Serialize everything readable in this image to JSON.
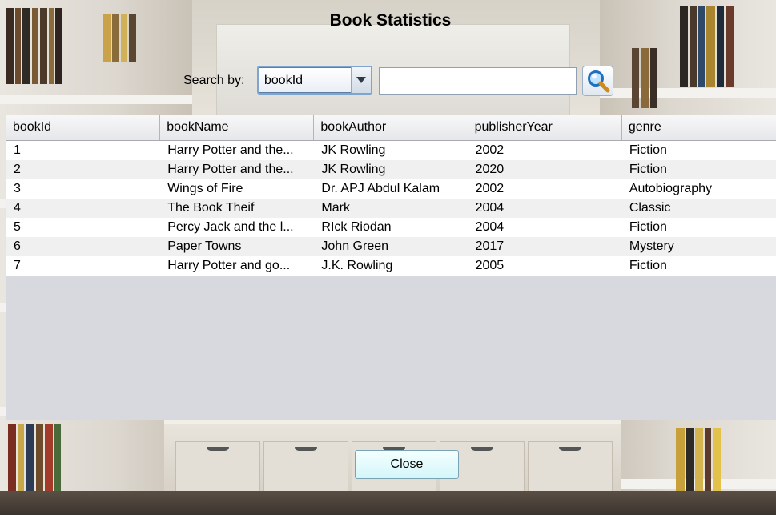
{
  "window": {
    "title": "Book Statistics"
  },
  "search": {
    "label": "Search by:",
    "selected_field": "bookId",
    "query_value": "",
    "button_icon": "magnifier-icon"
  },
  "table": {
    "columns": [
      "bookId",
      "bookName",
      "bookAuthor",
      "publisherYear",
      "genre"
    ],
    "rows": [
      [
        "1",
        "Harry Potter and the...",
        "JK Rowling",
        "2002",
        "Fiction"
      ],
      [
        "2",
        "Harry Potter and the...",
        "JK Rowling",
        "2020",
        "Fiction"
      ],
      [
        "3",
        "Wings of Fire",
        "Dr. APJ Abdul Kalam",
        "2002",
        "Autobiography"
      ],
      [
        "4",
        "The Book Theif",
        "Mark",
        "2004",
        "Classic"
      ],
      [
        "5",
        "Percy Jack and the l...",
        "RIck Riodan",
        "2004",
        "Fiction"
      ],
      [
        "6",
        "Paper Towns",
        "John Green",
        "2017",
        "Mystery"
      ],
      [
        "7",
        "Harry Potter and go...",
        "J.K. Rowling",
        "2005",
        "Fiction"
      ]
    ]
  },
  "footer": {
    "close_label": "Close"
  },
  "colors": {
    "header_bg": "#e6e7ea",
    "empty_table_bg": "#d7d9df",
    "close_button_bg": "#d4f6f9"
  }
}
